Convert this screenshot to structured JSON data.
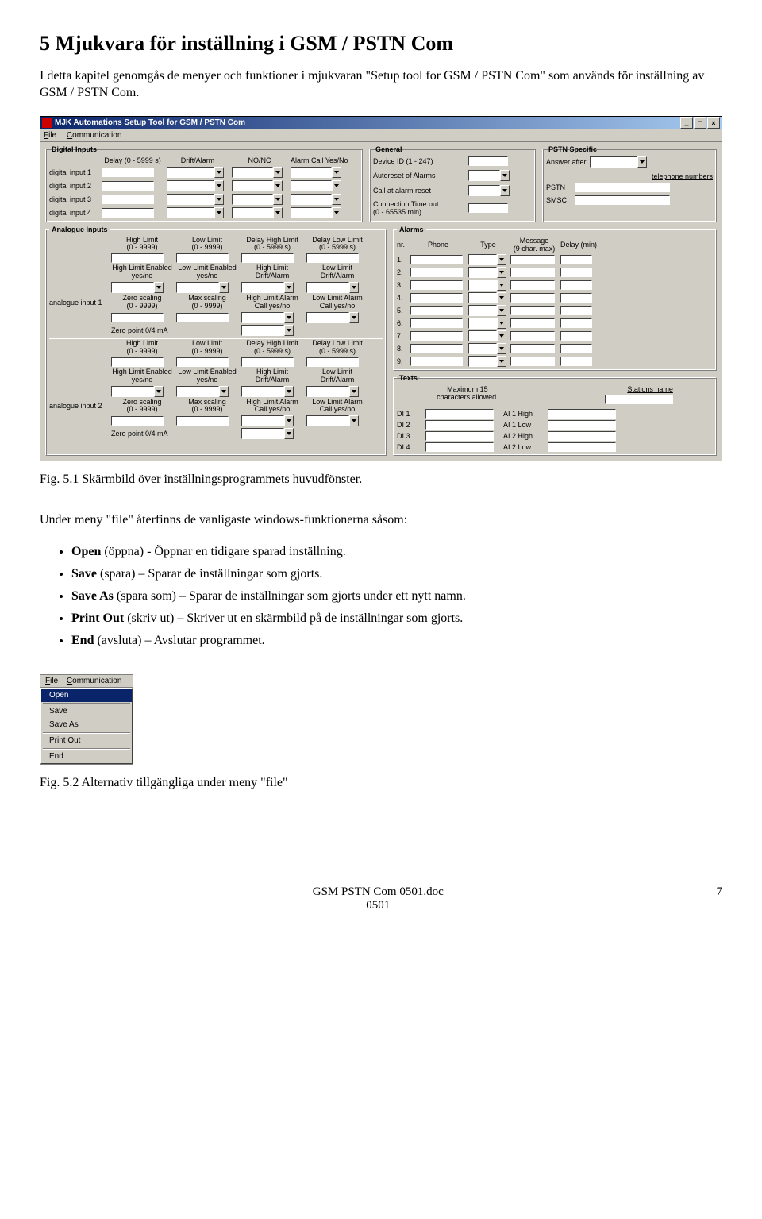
{
  "heading": "5 Mjukvara för inställning i GSM / PSTN Com",
  "intro": "I detta kapitel genomgås de menyer och funktioner i mjukvaran \"Setup tool for GSM / PSTN Com\" som används för inställning av GSM / PSTN Com.",
  "fig1_caption": "Fig. 5.1 Skärmbild över inställningsprogrammets huvudfönster.",
  "p_after": "Under meny \"file\" återfinns de vanligaste windows-funktionerna såsom:",
  "bullets": [
    {
      "b": "Open",
      "t": " (öppna) - Öppnar en tidigare sparad inställning."
    },
    {
      "b": "Save",
      "t": " (spara) – Sparar de inställningar som gjorts."
    },
    {
      "b": "Save As",
      "t": " (spara som) – Sparar de inställningar som gjorts under ett nytt namn."
    },
    {
      "b": "Print Out",
      "t": " (skriv ut) – Skriver ut en skärmbild på de inställningar som gjorts."
    },
    {
      "b": "End",
      "t": " (avsluta) – Avslutar programmet."
    }
  ],
  "fig2_caption": "Fig. 5.2 Alternativ tillgängliga under meny \"file\"",
  "footer_left": "GSM PSTN Com  0501.doc",
  "footer_center": "0501",
  "footer_right": "7",
  "win": {
    "title": "MJK Automations Setup Tool for GSM / PSTN Com",
    "menu_file": "File",
    "menu_comm": "Communication",
    "digin": {
      "legend": "Digital Inputs",
      "h_delay": "Delay (0 - 5999 s)",
      "h_drift": "Drift/Alarm",
      "h_nonc": "NO/NC",
      "h_call": "Alarm Call Yes/No",
      "rows": [
        "digital input 1",
        "digital input 2",
        "digital input 3",
        "digital input 4"
      ]
    },
    "general": {
      "legend": "General",
      "device": "Device ID (1 - 247)",
      "autorst": "Autoreset of Alarms",
      "callrst": "Call at alarm reset",
      "cto1": "Connection Time out",
      "cto2": "(0 - 65535 min)"
    },
    "pstn": {
      "legend": "PSTN Specific",
      "answer": "Answer after",
      "tel": "telephone numbers",
      "pstn_l": "PSTN",
      "smsc_l": "SMSC"
    },
    "ana": {
      "legend": "Analogue Inputs",
      "h_highlimit": "High Limit\n(0 - 9999)",
      "h_lowlimit": "Low Limit\n(0 - 9999)",
      "h_delayhigh": "Delay High Limit\n(0 - 5999 s)",
      "h_delaylow": "Delay Low Limit\n(0 - 5999 s)",
      "h_highen": "High Limit Enabled\nyes/no",
      "h_lowen": "Low Limit Enabled\nyes/no",
      "h_highdrift": "High Limit\nDrift/Alarm",
      "h_lowdrift": "Low Limit\nDrift/Alarm",
      "h_zero": "Zero scaling\n(0 - 9999)",
      "h_max": "Max scaling\n(0 - 9999)",
      "h_highcall": "High Limit Alarm\nCall yes/no",
      "h_lowcall": "Low Limit Alarm\nCall yes/no",
      "zeropt": "Zero point 0/4 mA",
      "row1": "analogue input 1",
      "row2": "analogue input 2"
    },
    "alarms": {
      "legend": "Alarms",
      "h_nr": "nr.",
      "h_phone": "Phone",
      "h_type": "Type",
      "h_msg": "Message\n(9 char. max)",
      "h_delay": "Delay (min)",
      "rows": [
        "1.",
        "2.",
        "3.",
        "4.",
        "5.",
        "6.",
        "7.",
        "8.",
        "9."
      ]
    },
    "texts": {
      "legend": "Texts",
      "max": "Maximum 15\ncharacters allowed.",
      "stations": "Stations name",
      "left": [
        "DI 1",
        "DI 2",
        "DI 3",
        "DI 4"
      ],
      "right": [
        "AI 1 High",
        "AI 1 Low",
        "AI 2 High",
        "AI 2 Low"
      ]
    }
  },
  "menu_fig": {
    "file": "File",
    "comm": "Communication",
    "items": [
      "Open",
      "Save",
      "Save As",
      "Print Out",
      "End"
    ]
  }
}
